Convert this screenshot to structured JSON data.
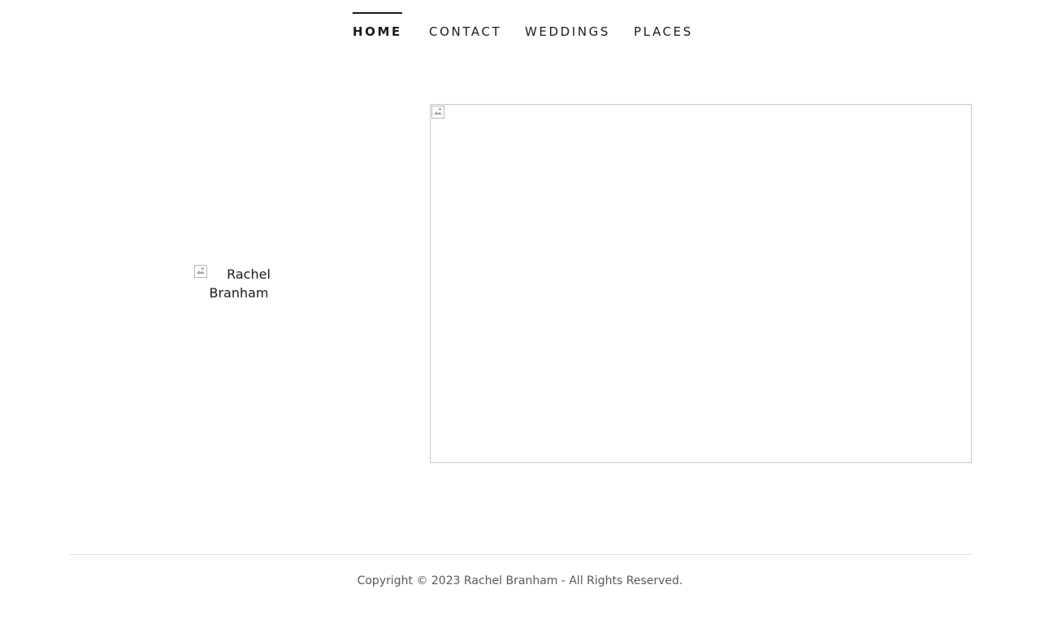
{
  "nav": {
    "items": [
      {
        "label": "HOME",
        "active": true
      },
      {
        "label": "CONTACT",
        "active": false
      },
      {
        "label": "WEDDINGS",
        "active": false
      },
      {
        "label": "PLACES",
        "active": false
      }
    ]
  },
  "logo": {
    "alt_text": "Rachel Branham",
    "icon": "broken-image-icon"
  },
  "hero": {
    "icon": "broken-image-icon"
  },
  "footer": {
    "copyright": "Copyright © 2023 Rachel Branham - All Rights Reserved."
  },
  "colors": {
    "text": "#1b1b1b",
    "footer_text": "#595959",
    "divider": "#e2e2e2",
    "image_border": "#c8c8c8"
  }
}
